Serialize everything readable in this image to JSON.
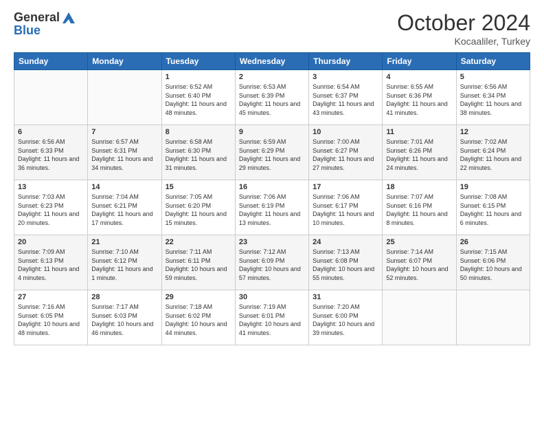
{
  "header": {
    "logo_line1": "General",
    "logo_line2": "Blue",
    "month": "October 2024",
    "location": "Kocaaliler, Turkey"
  },
  "weekdays": [
    "Sunday",
    "Monday",
    "Tuesday",
    "Wednesday",
    "Thursday",
    "Friday",
    "Saturday"
  ],
  "weeks": [
    [
      {
        "day": "",
        "info": ""
      },
      {
        "day": "",
        "info": ""
      },
      {
        "day": "1",
        "info": "Sunrise: 6:52 AM\nSunset: 6:40 PM\nDaylight: 11 hours and 48 minutes."
      },
      {
        "day": "2",
        "info": "Sunrise: 6:53 AM\nSunset: 6:39 PM\nDaylight: 11 hours and 45 minutes."
      },
      {
        "day": "3",
        "info": "Sunrise: 6:54 AM\nSunset: 6:37 PM\nDaylight: 11 hours and 43 minutes."
      },
      {
        "day": "4",
        "info": "Sunrise: 6:55 AM\nSunset: 6:36 PM\nDaylight: 11 hours and 41 minutes."
      },
      {
        "day": "5",
        "info": "Sunrise: 6:56 AM\nSunset: 6:34 PM\nDaylight: 11 hours and 38 minutes."
      }
    ],
    [
      {
        "day": "6",
        "info": "Sunrise: 6:56 AM\nSunset: 6:33 PM\nDaylight: 11 hours and 36 minutes."
      },
      {
        "day": "7",
        "info": "Sunrise: 6:57 AM\nSunset: 6:31 PM\nDaylight: 11 hours and 34 minutes."
      },
      {
        "day": "8",
        "info": "Sunrise: 6:58 AM\nSunset: 6:30 PM\nDaylight: 11 hours and 31 minutes."
      },
      {
        "day": "9",
        "info": "Sunrise: 6:59 AM\nSunset: 6:29 PM\nDaylight: 11 hours and 29 minutes."
      },
      {
        "day": "10",
        "info": "Sunrise: 7:00 AM\nSunset: 6:27 PM\nDaylight: 11 hours and 27 minutes."
      },
      {
        "day": "11",
        "info": "Sunrise: 7:01 AM\nSunset: 6:26 PM\nDaylight: 11 hours and 24 minutes."
      },
      {
        "day": "12",
        "info": "Sunrise: 7:02 AM\nSunset: 6:24 PM\nDaylight: 11 hours and 22 minutes."
      }
    ],
    [
      {
        "day": "13",
        "info": "Sunrise: 7:03 AM\nSunset: 6:23 PM\nDaylight: 11 hours and 20 minutes."
      },
      {
        "day": "14",
        "info": "Sunrise: 7:04 AM\nSunset: 6:21 PM\nDaylight: 11 hours and 17 minutes."
      },
      {
        "day": "15",
        "info": "Sunrise: 7:05 AM\nSunset: 6:20 PM\nDaylight: 11 hours and 15 minutes."
      },
      {
        "day": "16",
        "info": "Sunrise: 7:06 AM\nSunset: 6:19 PM\nDaylight: 11 hours and 13 minutes."
      },
      {
        "day": "17",
        "info": "Sunrise: 7:06 AM\nSunset: 6:17 PM\nDaylight: 11 hours and 10 minutes."
      },
      {
        "day": "18",
        "info": "Sunrise: 7:07 AM\nSunset: 6:16 PM\nDaylight: 11 hours and 8 minutes."
      },
      {
        "day": "19",
        "info": "Sunrise: 7:08 AM\nSunset: 6:15 PM\nDaylight: 11 hours and 6 minutes."
      }
    ],
    [
      {
        "day": "20",
        "info": "Sunrise: 7:09 AM\nSunset: 6:13 PM\nDaylight: 11 hours and 4 minutes."
      },
      {
        "day": "21",
        "info": "Sunrise: 7:10 AM\nSunset: 6:12 PM\nDaylight: 11 hours and 1 minute."
      },
      {
        "day": "22",
        "info": "Sunrise: 7:11 AM\nSunset: 6:11 PM\nDaylight: 10 hours and 59 minutes."
      },
      {
        "day": "23",
        "info": "Sunrise: 7:12 AM\nSunset: 6:09 PM\nDaylight: 10 hours and 57 minutes."
      },
      {
        "day": "24",
        "info": "Sunrise: 7:13 AM\nSunset: 6:08 PM\nDaylight: 10 hours and 55 minutes."
      },
      {
        "day": "25",
        "info": "Sunrise: 7:14 AM\nSunset: 6:07 PM\nDaylight: 10 hours and 52 minutes."
      },
      {
        "day": "26",
        "info": "Sunrise: 7:15 AM\nSunset: 6:06 PM\nDaylight: 10 hours and 50 minutes."
      }
    ],
    [
      {
        "day": "27",
        "info": "Sunrise: 7:16 AM\nSunset: 6:05 PM\nDaylight: 10 hours and 48 minutes."
      },
      {
        "day": "28",
        "info": "Sunrise: 7:17 AM\nSunset: 6:03 PM\nDaylight: 10 hours and 46 minutes."
      },
      {
        "day": "29",
        "info": "Sunrise: 7:18 AM\nSunset: 6:02 PM\nDaylight: 10 hours and 44 minutes."
      },
      {
        "day": "30",
        "info": "Sunrise: 7:19 AM\nSunset: 6:01 PM\nDaylight: 10 hours and 41 minutes."
      },
      {
        "day": "31",
        "info": "Sunrise: 7:20 AM\nSunset: 6:00 PM\nDaylight: 10 hours and 39 minutes."
      },
      {
        "day": "",
        "info": ""
      },
      {
        "day": "",
        "info": ""
      }
    ]
  ]
}
